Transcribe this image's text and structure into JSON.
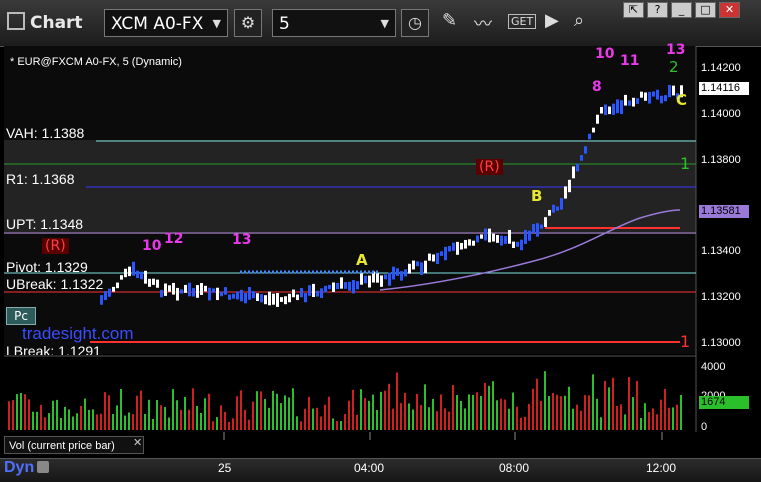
{
  "toolbar": {
    "app_title": "Chart",
    "symbol": "XCM A0-FX",
    "interval": "5",
    "get_label": "GET"
  },
  "chart": {
    "symbol_line": "* EUR@FXCM A0-FX, 5 (Dynamic)",
    "levels": [
      {
        "label": "VAH: 1.1388",
        "color": "#7fe0e0"
      },
      {
        "label": "R1: 1.1368",
        "color": "#3a3aff"
      },
      {
        "label": "UPT: 1.1348",
        "color": "#b08ad8"
      },
      {
        "label": "Pivot: 1.1329",
        "color": "#7fe0e0"
      },
      {
        "label": "UBreak: 1.1322",
        "color": "#ff3030"
      },
      {
        "label": "LBreak: 1.1291",
        "color": "#ff3030"
      }
    ],
    "price_axis": [
      "1.14200",
      "1.14000",
      "1.13800",
      "1.13600",
      "1.13400",
      "1.13200",
      "1.13000"
    ],
    "last_price": "1.14116",
    "upt_price": "1.13581",
    "side_counts": {
      "top": "2",
      "mid": "1",
      "bottom": "1"
    },
    "letters": [
      "A",
      "B",
      "C"
    ],
    "counts": [
      "10",
      "12",
      "13",
      "8",
      "10",
      "11",
      "13"
    ],
    "rtag": "R",
    "watermark": "tradesight.com",
    "pv_label": "Pc"
  },
  "volume": {
    "label": "Vol (current price bar)",
    "axis": [
      "4000",
      "2000",
      "0"
    ],
    "last": "1674"
  },
  "time_axis": [
    "25",
    "04:00",
    "08:00",
    "12:00"
  ],
  "bottom": {
    "dyn_label": "Dyn"
  }
}
